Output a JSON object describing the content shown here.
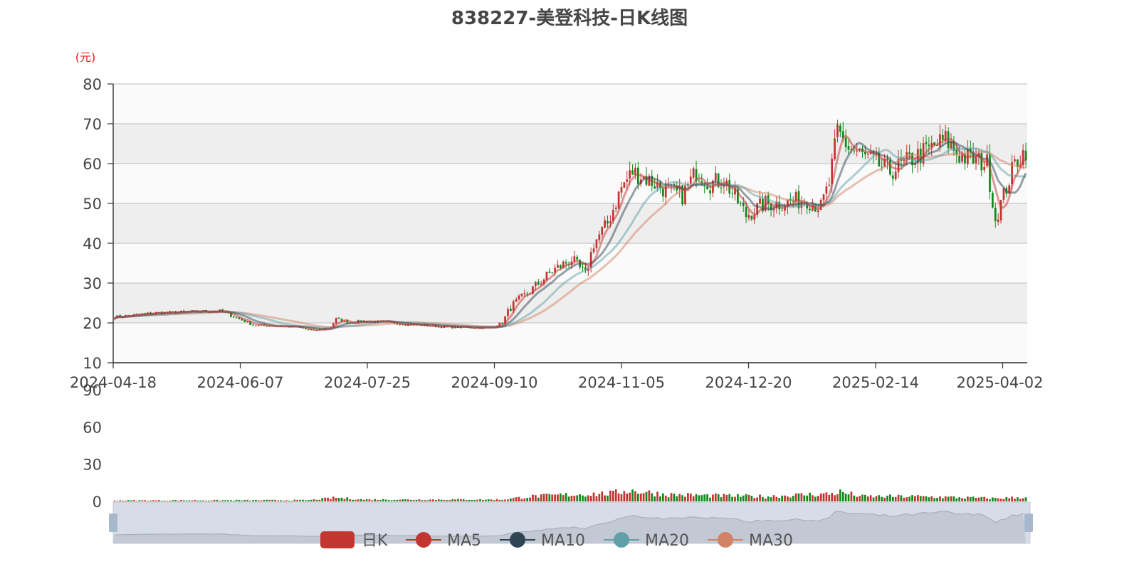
{
  "chart_data": {
    "type": "candlestick",
    "title": "838227-美登科技-日K线图",
    "y_unit": "(元)",
    "price_axis": {
      "range": [
        10,
        80
      ],
      "ticks": [
        "80",
        "70",
        "60",
        "50",
        "40",
        "30",
        "20",
        "10"
      ]
    },
    "volume_axis": {
      "range": [
        0,
        90
      ],
      "ticks": [
        "90",
        "60",
        "30",
        "0"
      ]
    },
    "x_ticks": [
      "2024-04-18",
      "2024-06-07",
      "2024-07-25",
      "2024-09-10",
      "2024-11-05",
      "2024-12-20",
      "2025-02-14",
      "2025-04-02"
    ],
    "legend": [
      "日K",
      "MA5",
      "MA10",
      "MA20",
      "MA30"
    ],
    "colors": {
      "up": "#c23531",
      "down": "#0f8a1a",
      "MA5": "#c23531",
      "MA10": "#2f4554",
      "MA20": "#61a0a8",
      "MA30": "#d48265"
    },
    "price_anchors": [
      [
        0,
        21.5
      ],
      [
        15,
        22.5
      ],
      [
        30,
        22.8
      ],
      [
        38,
        23.0
      ],
      [
        45,
        21.0
      ],
      [
        50,
        19.5
      ],
      [
        65,
        19.0
      ],
      [
        72,
        18.0
      ],
      [
        78,
        19.0
      ],
      [
        80,
        21.0
      ],
      [
        85,
        20.0
      ],
      [
        90,
        20.5
      ],
      [
        100,
        20.0
      ],
      [
        110,
        19.5
      ],
      [
        120,
        19.0
      ],
      [
        135,
        18.8
      ],
      [
        140,
        20.0
      ],
      [
        143,
        24.0
      ],
      [
        150,
        28.0
      ],
      [
        158,
        33.0
      ],
      [
        165,
        36.0
      ],
      [
        170,
        32.0
      ],
      [
        173,
        40.0
      ],
      [
        178,
        45.0
      ],
      [
        183,
        54.0
      ],
      [
        187,
        58.0
      ],
      [
        190,
        57.0
      ],
      [
        195,
        55.0
      ],
      [
        200,
        53.0
      ],
      [
        205,
        52.0
      ],
      [
        210,
        58.0
      ],
      [
        215,
        55.0
      ],
      [
        220,
        56.0
      ],
      [
        228,
        47.0
      ],
      [
        235,
        50.0
      ],
      [
        240,
        50.0
      ],
      [
        250,
        51.0
      ],
      [
        255,
        49.0
      ],
      [
        258,
        55.0
      ],
      [
        261,
        68.0
      ],
      [
        265,
        64.0
      ],
      [
        270,
        62.0
      ],
      [
        280,
        58.0
      ],
      [
        290,
        62.0
      ],
      [
        300,
        66.0
      ],
      [
        305,
        62.0
      ],
      [
        310,
        61.0
      ],
      [
        315,
        60.0
      ],
      [
        318,
        46.0
      ],
      [
        321,
        52.0
      ],
      [
        325,
        60.0
      ],
      [
        330,
        64.5
      ]
    ],
    "volume_anchors": [
      [
        0,
        0.8
      ],
      [
        70,
        1.0
      ],
      [
        80,
        3.0
      ],
      [
        90,
        1.5
      ],
      [
        140,
        1.5
      ],
      [
        150,
        4.0
      ],
      [
        165,
        5.5
      ],
      [
        180,
        6.5
      ],
      [
        185,
        9.0
      ],
      [
        200,
        5.5
      ],
      [
        220,
        4.5
      ],
      [
        235,
        4.0
      ],
      [
        250,
        5.5
      ],
      [
        258,
        6.0
      ],
      [
        262,
        7.5
      ],
      [
        270,
        4.0
      ],
      [
        290,
        4.0
      ],
      [
        300,
        3.5
      ],
      [
        318,
        2.5
      ],
      [
        330,
        3.5
      ]
    ],
    "num_days": 330
  }
}
